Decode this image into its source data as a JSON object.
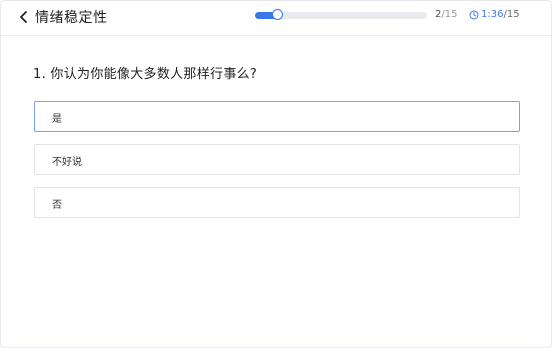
{
  "header": {
    "title": "情绪稳定性",
    "progress": {
      "current": "2",
      "total": "/15",
      "fraction": 0.133
    },
    "timer": {
      "elapsed": "1:36",
      "limit": "/15"
    }
  },
  "question": {
    "text": "1. 你认为你能像大多数人那样行事么?",
    "options": [
      {
        "label": "是",
        "selected": true
      },
      {
        "label": "不好说",
        "selected": false
      },
      {
        "label": "否",
        "selected": false
      }
    ]
  },
  "colors": {
    "accent": "#3a78e8",
    "track": "#e9eaee",
    "border": "#e1e3e8",
    "selected_border": "#7aa5ee"
  },
  "icons": {
    "back": "chevron-left-icon",
    "timer": "clock-icon"
  }
}
